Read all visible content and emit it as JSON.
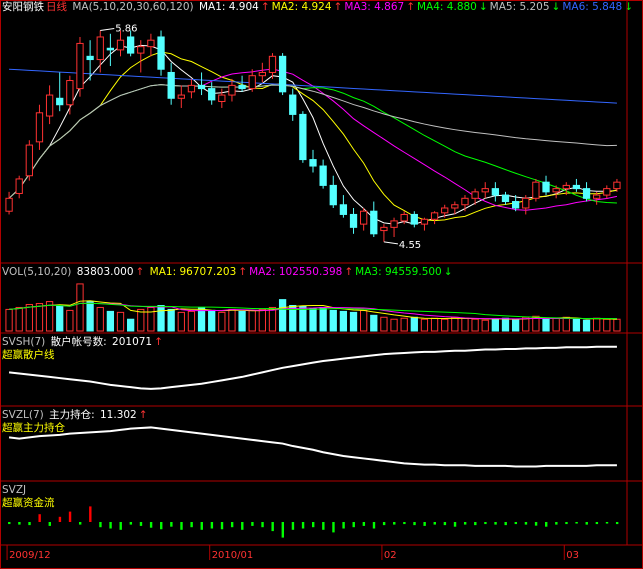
{
  "main": {
    "stock_name": "安阳钢铁",
    "period": "日线",
    "ma_params": "MA(5,10,20,30,60,120)",
    "ma": [
      {
        "label": "MA1:",
        "value": "4.904",
        "arrow": "↑",
        "color": "#ffffff"
      },
      {
        "label": "MA2:",
        "value": "4.924",
        "arrow": "↑",
        "color": "#ffff00"
      },
      {
        "label": "MA3:",
        "value": "4.867",
        "arrow": "↑",
        "color": "#ff00ff"
      },
      {
        "label": "MA4:",
        "value": "4.880",
        "arrow": "↓",
        "color": "#00ff00"
      },
      {
        "label": "MA5:",
        "value": "5.205",
        "arrow": "↓",
        "color": "#c0c0c0"
      },
      {
        "label": "MA6:",
        "value": "5.848",
        "arrow": "↓",
        "color": "#3366ff"
      }
    ],
    "high_label": "5.86",
    "low_label": "4.55"
  },
  "vol": {
    "params": "VOL(5,10,20)",
    "current": "83803.000",
    "current_arrow": "↑",
    "ma": [
      {
        "label": "MA1:",
        "value": "96707.203",
        "arrow": "↑",
        "color": "#ffff00"
      },
      {
        "label": "MA2:",
        "value": "102550.398",
        "arrow": "↑",
        "color": "#ff00ff"
      },
      {
        "label": "MA3:",
        "value": "94559.500",
        "arrow": "↓",
        "color": "#00ff00"
      }
    ]
  },
  "svsh": {
    "params": "SVSH(7)",
    "label": "散户帐号数:",
    "value": "201071",
    "arrow": "↑",
    "title": "超赢散户线"
  },
  "svzl": {
    "params": "SVZL(7)",
    "label": "主力持仓:",
    "value": "11.302",
    "arrow": "↑",
    "title": "超赢主力持仓"
  },
  "svzj": {
    "params": "SVZJ",
    "title": "超赢资金流"
  },
  "date_axis": [
    "2009/12",
    "2010/01",
    "02",
    "03"
  ],
  "chart_data": [
    {
      "type": "candlestick",
      "ylim": [
        4.45,
        5.95
      ],
      "grid": false,
      "note": "OHLC per trading day (open, high, low, close), approximate",
      "candles": [
        [
          4.74,
          4.86,
          4.72,
          4.82
        ],
        [
          4.85,
          4.96,
          4.82,
          4.94
        ],
        [
          4.96,
          5.18,
          4.93,
          5.15
        ],
        [
          5.17,
          5.4,
          5.12,
          5.35
        ],
        [
          5.33,
          5.52,
          5.28,
          5.46
        ],
        [
          5.44,
          5.6,
          5.36,
          5.4
        ],
        [
          5.4,
          5.58,
          5.34,
          5.55
        ],
        [
          5.5,
          5.82,
          5.45,
          5.78
        ],
        [
          5.7,
          5.8,
          5.55,
          5.68
        ],
        [
          5.68,
          5.86,
          5.6,
          5.82
        ],
        [
          5.75,
          5.84,
          5.64,
          5.74
        ],
        [
          5.74,
          5.86,
          5.7,
          5.8
        ],
        [
          5.82,
          5.86,
          5.7,
          5.72
        ],
        [
          5.72,
          5.8,
          5.6,
          5.76
        ],
        [
          5.76,
          5.84,
          5.7,
          5.8
        ],
        [
          5.82,
          5.86,
          5.58,
          5.62
        ],
        [
          5.6,
          5.66,
          5.4,
          5.44
        ],
        [
          5.44,
          5.52,
          5.38,
          5.46
        ],
        [
          5.48,
          5.56,
          5.44,
          5.52
        ],
        [
          5.52,
          5.6,
          5.46,
          5.5
        ],
        [
          5.5,
          5.54,
          5.4,
          5.43
        ],
        [
          5.42,
          5.5,
          5.38,
          5.46
        ],
        [
          5.46,
          5.56,
          5.42,
          5.52
        ],
        [
          5.52,
          5.58,
          5.48,
          5.5
        ],
        [
          5.5,
          5.62,
          5.48,
          5.58
        ],
        [
          5.58,
          5.66,
          5.54,
          5.6
        ],
        [
          5.6,
          5.72,
          5.56,
          5.7
        ],
        [
          5.7,
          5.72,
          5.46,
          5.48
        ],
        [
          5.46,
          5.5,
          5.3,
          5.34
        ],
        [
          5.34,
          5.36,
          5.04,
          5.06
        ],
        [
          5.06,
          5.12,
          4.98,
          5.02
        ],
        [
          5.02,
          5.06,
          4.88,
          4.9
        ],
        [
          4.9,
          4.96,
          4.76,
          4.78
        ],
        [
          4.78,
          4.84,
          4.7,
          4.72
        ],
        [
          4.72,
          4.76,
          4.6,
          4.64
        ],
        [
          4.66,
          4.76,
          4.62,
          4.74
        ],
        [
          4.74,
          4.8,
          4.58,
          4.6
        ],
        [
          4.62,
          4.66,
          4.55,
          4.64
        ],
        [
          4.64,
          4.7,
          4.58,
          4.68
        ],
        [
          4.68,
          4.74,
          4.66,
          4.72
        ],
        [
          4.72,
          4.74,
          4.64,
          4.66
        ],
        [
          4.66,
          4.7,
          4.62,
          4.69
        ],
        [
          4.69,
          4.74,
          4.66,
          4.73
        ],
        [
          4.73,
          4.78,
          4.7,
          4.76
        ],
        [
          4.76,
          4.8,
          4.72,
          4.78
        ],
        [
          4.78,
          4.84,
          4.74,
          4.82
        ],
        [
          4.82,
          4.88,
          4.78,
          4.86
        ],
        [
          4.86,
          4.92,
          4.82,
          4.88
        ],
        [
          4.88,
          4.92,
          4.8,
          4.84
        ],
        [
          4.84,
          4.86,
          4.78,
          4.8
        ],
        [
          4.8,
          4.84,
          4.74,
          4.76
        ],
        [
          4.76,
          4.84,
          4.72,
          4.82
        ],
        [
          4.82,
          4.94,
          4.8,
          4.92
        ],
        [
          4.92,
          4.96,
          4.84,
          4.86
        ],
        [
          4.86,
          4.9,
          4.82,
          4.88
        ],
        [
          4.88,
          4.92,
          4.84,
          4.9
        ],
        [
          4.9,
          4.94,
          4.86,
          4.88
        ],
        [
          4.88,
          4.92,
          4.8,
          4.82
        ],
        [
          4.82,
          4.86,
          4.78,
          4.84
        ],
        [
          4.84,
          4.9,
          4.82,
          4.88
        ],
        [
          4.88,
          4.94,
          4.86,
          4.92
        ]
      ]
    },
    {
      "type": "bar",
      "ylim": [
        0,
        260000
      ],
      "note": "daily volume, approximate",
      "values": [
        110000,
        120000,
        135000,
        140000,
        150000,
        125000,
        105000,
        240000,
        150000,
        120000,
        100000,
        95000,
        60000,
        110000,
        120000,
        130000,
        110000,
        95000,
        100000,
        120000,
        105000,
        95000,
        110000,
        100000,
        105000,
        110000,
        120000,
        160000,
        130000,
        125000,
        115000,
        120000,
        105000,
        100000,
        95000,
        105000,
        80000,
        70000,
        60000,
        65000,
        70000,
        60000,
        65000,
        60000,
        70000,
        65000,
        60000,
        55000,
        60000,
        65000,
        60000,
        70000,
        75000,
        60000,
        65000,
        70000,
        60000,
        55000,
        65000,
        60000,
        60000
      ]
    },
    {
      "type": "line",
      "name": "超赢散户线",
      "ylim": [
        0,
        100
      ],
      "values": [
        52,
        50,
        48,
        46,
        44,
        42,
        40,
        38,
        36,
        33,
        30,
        28,
        26,
        24,
        23,
        24,
        26,
        28,
        30,
        32,
        35,
        38,
        41,
        44,
        48,
        52,
        56,
        60,
        63,
        66,
        69,
        72,
        74,
        76,
        78,
        80,
        82,
        84,
        85,
        86,
        87,
        88,
        88,
        89,
        90,
        90,
        91,
        92,
        92,
        93,
        93,
        94,
        94,
        95,
        95,
        96,
        96,
        96,
        97,
        97,
        97
      ]
    },
    {
      "type": "line",
      "name": "超赢主力持仓",
      "ylim": [
        0,
        100
      ],
      "values": [
        72,
        70,
        72,
        74,
        75,
        76,
        78,
        79,
        80,
        81,
        82,
        84,
        86,
        87,
        88,
        86,
        84,
        82,
        80,
        78,
        76,
        74,
        72,
        70,
        68,
        66,
        64,
        62,
        58,
        55,
        52,
        48,
        45,
        42,
        40,
        38,
        36,
        34,
        32,
        30,
        29,
        28,
        28,
        27,
        27,
        27,
        26,
        26,
        26,
        26,
        25,
        25,
        25,
        26,
        26,
        26,
        26,
        26,
        27,
        27,
        27
      ]
    },
    {
      "type": "bar",
      "name": "超赢资金流",
      "ylim": [
        -100,
        100
      ],
      "values": [
        -8,
        -10,
        -12,
        30,
        -15,
        20,
        40,
        -10,
        60,
        -20,
        -25,
        -30,
        -10,
        -15,
        -22,
        -28,
        -18,
        -30,
        -20,
        -30,
        -25,
        -28,
        -20,
        -30,
        -15,
        -20,
        -35,
        -60,
        -30,
        -25,
        -20,
        -30,
        -40,
        -25,
        -20,
        -15,
        -25,
        -12,
        -10,
        -8,
        -12,
        -15,
        -10,
        -12,
        -18,
        -10,
        -12,
        -8,
        -10,
        -12,
        -8,
        -10,
        -14,
        -18,
        -10,
        -8,
        -6,
        -10,
        -8,
        -6,
        -8
      ]
    }
  ]
}
